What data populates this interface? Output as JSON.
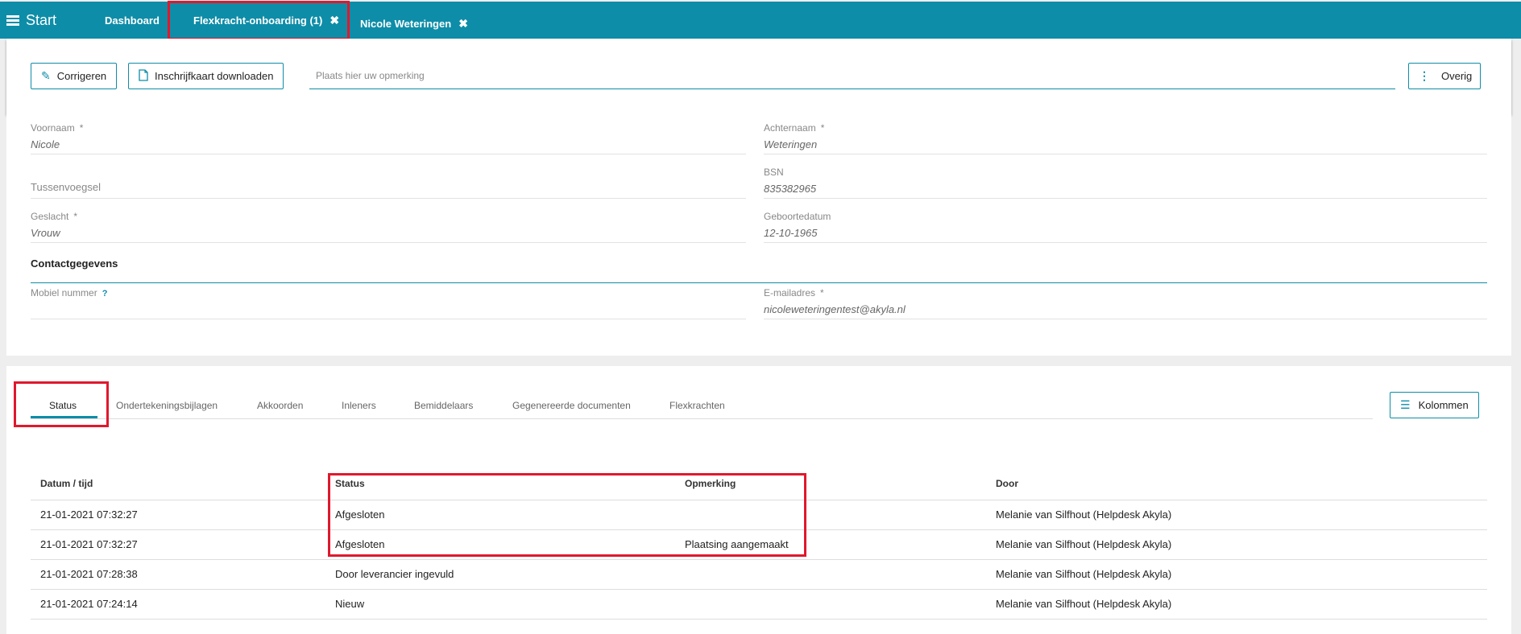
{
  "topbar": {
    "start_label": "Start",
    "tabs": [
      {
        "label": "Dashboard"
      },
      {
        "label": "Flexkracht-onboarding (1)",
        "close": "✖"
      },
      {
        "label": "Nicole Weteringen",
        "close": "✖"
      }
    ]
  },
  "toolbar": {
    "correct_label": "Corrigeren",
    "download_label": "Inschrijfkaart downloaden",
    "remark_placeholder": "Plaats hier uw opmerking",
    "more_label": "Overig"
  },
  "form": {
    "fields": [
      {
        "label": "Voornaam",
        "required": "*",
        "value": "Nicole"
      },
      {
        "label": "Achternaam",
        "required": "*",
        "value": "Weteringen"
      },
      {
        "label": "Tussenvoegsel",
        "value": ""
      },
      {
        "label": "BSN",
        "value": "835382965"
      },
      {
        "label": "Geslacht",
        "required": "*",
        "value": "Vrouw"
      },
      {
        "label": "Geboortedatum",
        "value": "12-10-1965"
      }
    ],
    "contact_title": "Contactgegevens",
    "contact_fields": [
      {
        "label": "Mobiel nummer",
        "help": "?",
        "value": ""
      },
      {
        "label": "E-mailadres",
        "required": "*",
        "value": "nicoleweteringentest@akyla.nl"
      }
    ]
  },
  "subtabs": [
    {
      "label": "Status",
      "active": true
    },
    {
      "label": "Ondertekeningsbijlagen"
    },
    {
      "label": "Akkoorden"
    },
    {
      "label": "Inleners"
    },
    {
      "label": "Bemiddelaars"
    },
    {
      "label": "Gegenereerde documenten"
    },
    {
      "label": "Flexkrachten"
    }
  ],
  "columns_button": "Kolommen",
  "table": {
    "headers": [
      "Datum / tijd",
      "Status",
      "Opmerking",
      "Door"
    ],
    "rows": [
      [
        "21-01-2021 07:32:27",
        "Afgesloten",
        "",
        "Melanie van Silfhout (Helpdesk Akyla)"
      ],
      [
        "21-01-2021 07:32:27",
        "Afgesloten",
        "Plaatsing aangemaakt",
        "Melanie van Silfhout (Helpdesk Akyla)"
      ],
      [
        "21-01-2021 07:28:38",
        "Door leverancier ingevuld",
        "",
        "Melanie van Silfhout (Helpdesk Akyla)"
      ],
      [
        "21-01-2021 07:24:14",
        "Nieuw",
        "",
        "Melanie van Silfhout (Helpdesk Akyla)"
      ]
    ]
  },
  "colors": {
    "accent": "#0e8da8",
    "highlight": "#e0182d"
  },
  "icons": [
    "hamburger-icon",
    "close-icon",
    "pencil-icon",
    "pdf-icon",
    "more-vert-icon",
    "list-icon"
  ]
}
